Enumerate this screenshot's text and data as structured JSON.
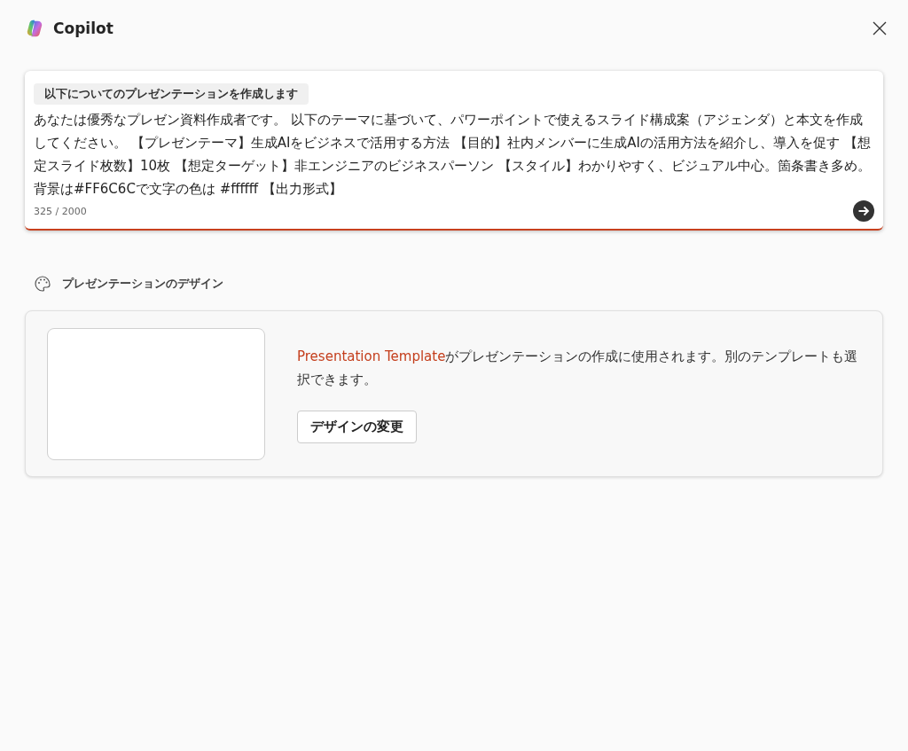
{
  "header": {
    "title": "Copilot"
  },
  "prompt": {
    "chip": "以下についてのプレゼンテーションを作成します",
    "value": "あなたは優秀なプレゼン資料作成者です。 以下のテーマに基づいて、パワーポイントで使えるスライド構成案（アジェンダ）と本文を作成してください。 【プレゼンテーマ】生成AIをビジネスで活用する方法 【目的】社内メンバーに生成AIの活用方法を紹介し、導入を促す 【想定スライド枚数】10枚 【想定ターゲット】非エンジニアのビジネスパーソン 【スタイル】わかりやすく、ビジュアル中心。箇条書き多め。背景は#FF6C6Cで文字の色は #ffffff 【出力形式】",
    "counter": "325 / 2000"
  },
  "design": {
    "heading": "プレゼンテーションのデザイン",
    "link": "Presentation Template",
    "description": "がプレゼンテーションの作成に使用されます。別のテンプレートも選択できます。",
    "button": "デザインの変更"
  }
}
